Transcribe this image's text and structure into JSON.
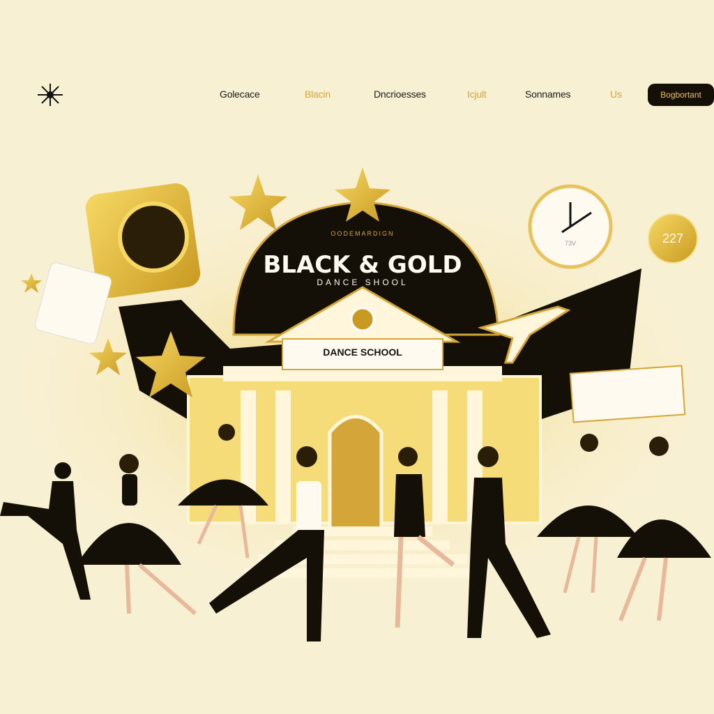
{
  "nav": {
    "logo_icon": "starburst-logo-icon",
    "items": [
      {
        "label": "Golecace",
        "accent": false
      },
      {
        "label": "Blacin",
        "accent": true
      },
      {
        "label": "Dncrioesses",
        "accent": false
      },
      {
        "label": "Icjult",
        "accent": true
      },
      {
        "label": "Sonnames",
        "accent": false
      },
      {
        "label": "Us",
        "accent": true
      }
    ],
    "cta_label": "Bogbortant"
  },
  "hero": {
    "kicker": "OODEMARDIGN",
    "title": "BLACK & GOLD",
    "subtitle": "DANCE SHOOL",
    "sign": "DANCE SCHOOL",
    "badge": "227",
    "clock_text": "73V"
  },
  "colors": {
    "background": "#f8f0d2",
    "gold": "#d4a63a",
    "black": "#141008"
  }
}
